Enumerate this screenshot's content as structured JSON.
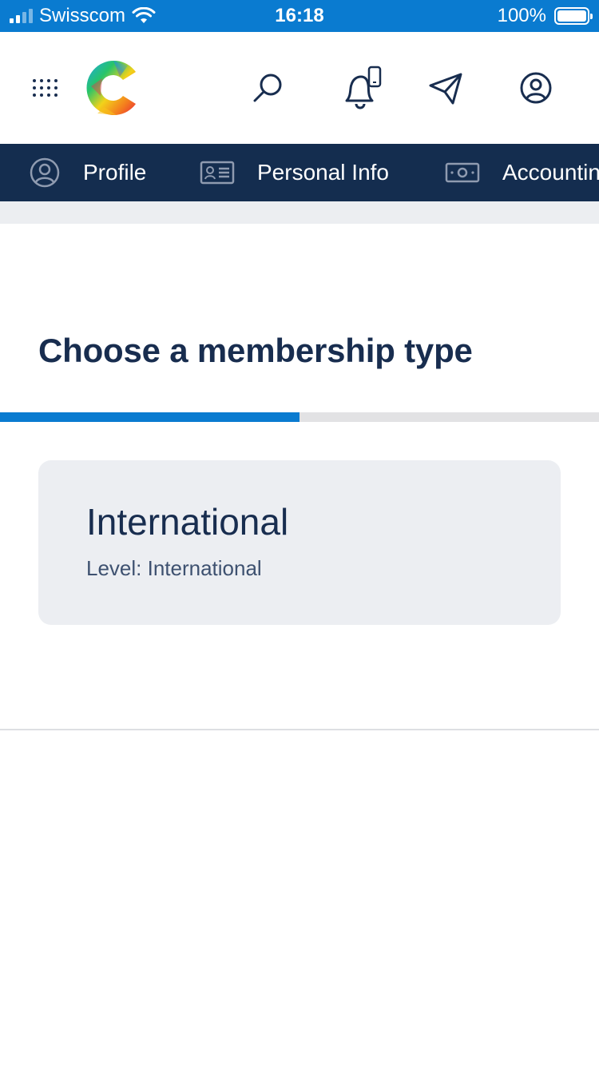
{
  "status_bar": {
    "carrier": "Swisscom",
    "time": "16:18",
    "battery": "100%"
  },
  "header": {
    "icons": [
      "apps-grid-icon",
      "logo",
      "search-icon",
      "bell-icon",
      "send-icon",
      "account-icon"
    ]
  },
  "tabs": [
    {
      "label": "Profile",
      "icon": "user-circle-icon"
    },
    {
      "label": "Personal Info",
      "icon": "id-card-icon"
    },
    {
      "label": "Accountin",
      "icon": "banknote-icon"
    }
  ],
  "main": {
    "title": "Choose a membership type",
    "progress": 0.5,
    "options": [
      {
        "title": "International",
        "subtitle": "Level: International"
      }
    ]
  },
  "colors": {
    "status_bar": "#0a7bd0",
    "tab_bar": "#142d4f",
    "primary_text": "#182d4f",
    "accent": "#0a7bd0"
  }
}
